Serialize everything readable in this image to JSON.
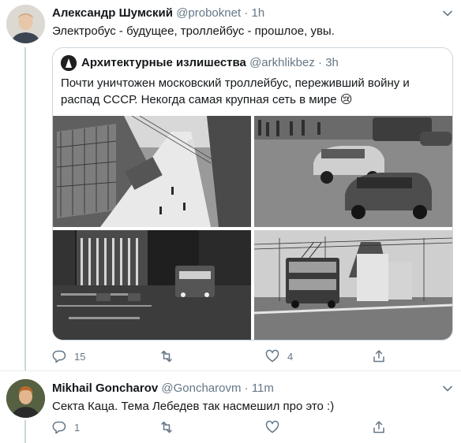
{
  "tweets": [
    {
      "name": "Александр Шумский",
      "handle": "@proboknet",
      "dot": "·",
      "time": "1h",
      "text": "Электробус - будущее, троллейбус - прошлое, увы.",
      "quote": {
        "name": "Архитектурные излишества",
        "handle": "@arkhlikbez",
        "dot": "·",
        "time": "3h",
        "text_line1": "Почти уничтожен московский троллейбус, переживший войну и",
        "text_line2": "распад СССР. Некогда самая крупная сеть в мире",
        "emoji": "😢",
        "photos": [
          "winter-street-trolleybus",
          "vintage-cars-street",
          "night-street-trolleybus",
          "double-decker-trolleybus"
        ]
      },
      "replies": "15",
      "retweets": "",
      "likes": "4"
    },
    {
      "name": "Mikhail Goncharov",
      "handle": "@Goncharovm",
      "dot": "·",
      "time": "11m",
      "text": "Секта Каца. Тема Лебедев так насмешил про это :)",
      "replies": "1",
      "retweets": "",
      "likes": ""
    }
  ],
  "colors": {
    "text": "#14171a",
    "secondary": "#657786",
    "border": "#ccd6dd"
  },
  "icons": [
    "reply-icon",
    "retweet-icon",
    "like-icon",
    "share-icon",
    "caret-down-icon"
  ]
}
